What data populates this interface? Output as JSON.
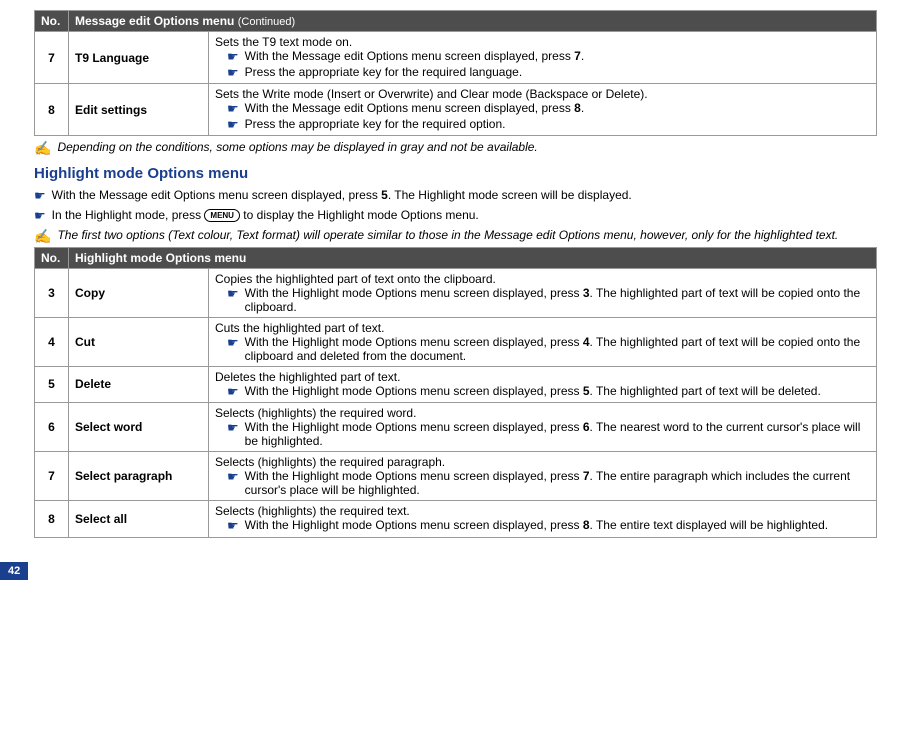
{
  "table1": {
    "header_no": "No.",
    "header_title": "Message edit Options menu",
    "header_cont": "(Continued)",
    "rows": [
      {
        "num": "7",
        "name": "T9 Language",
        "intro": "Sets the T9 text mode on.",
        "b1a": "With the Message edit Options menu screen displayed, press ",
        "b1key": "7",
        "b1b": ".",
        "b2": "Press the appropriate key for the required language."
      },
      {
        "num": "8",
        "name": "Edit settings",
        "intro": "Sets the Write mode (Insert or Overwrite) and Clear mode (Backspace or Delete).",
        "b1a": "With the Message edit Options menu screen displayed, press ",
        "b1key": "8",
        "b1b": ".",
        "b2": "Press the appropriate key for the required option."
      }
    ]
  },
  "note1": "Depending on the conditions, some options may be displayed in gray and not be available.",
  "heading": "Highlight mode Options menu",
  "action1a": "With the Message edit Options menu screen displayed, press ",
  "action1key": "5",
  "action1b": ". The Highlight mode screen will be displayed.",
  "action2a": "In the Highlight mode, press ",
  "menu_label": "MENU",
  "action2b": " to display the Highlight mode Options menu.",
  "note2": "The first two options (Text colour, Text format) will operate similar to those in the Message edit Options menu, however, only for the highlighted text.",
  "table2": {
    "header_no": "No.",
    "header_title": "Highlight mode Options menu",
    "rows": [
      {
        "num": "3",
        "name": "Copy",
        "intro": "Copies the highlighted part of text onto the clipboard.",
        "b1a": "With the Highlight mode Options menu screen displayed, press ",
        "b1key": "3",
        "b1b": ". The highlighted part of text will be copied onto the clipboard."
      },
      {
        "num": "4",
        "name": "Cut",
        "intro": "Cuts the highlighted part of text.",
        "b1a": "With the Highlight mode Options menu screen displayed, press ",
        "b1key": "4",
        "b1b": ". The highlighted part of text will be copied onto the clipboard and deleted from the document."
      },
      {
        "num": "5",
        "name": "Delete",
        "intro": "Deletes the highlighted part of text.",
        "b1a": "With the Highlight mode Options menu screen displayed, press ",
        "b1key": "5",
        "b1b": ". The highlighted part of text will be deleted."
      },
      {
        "num": "6",
        "name": "Select word",
        "intro": "Selects (highlights) the required word.",
        "b1a": "With the Highlight mode Options menu screen displayed, press ",
        "b1key": "6",
        "b1b": ". The nearest word to the current cursor's place will be highlighted."
      },
      {
        "num": "7",
        "name": "Select paragraph",
        "intro": "Selects (highlights) the required paragraph.",
        "b1a": "With the Highlight mode Options menu screen displayed, press ",
        "b1key": "7",
        "b1b": ". The entire paragraph which includes the current cursor's place will be highlighted."
      },
      {
        "num": "8",
        "name": "Select all",
        "intro": "Selects (highlights) the required text.",
        "b1a": "With the Highlight mode Options menu screen displayed, press ",
        "b1key": "8",
        "b1b": ". The entire text displayed will be highlighted."
      }
    ]
  },
  "page_number": "42"
}
